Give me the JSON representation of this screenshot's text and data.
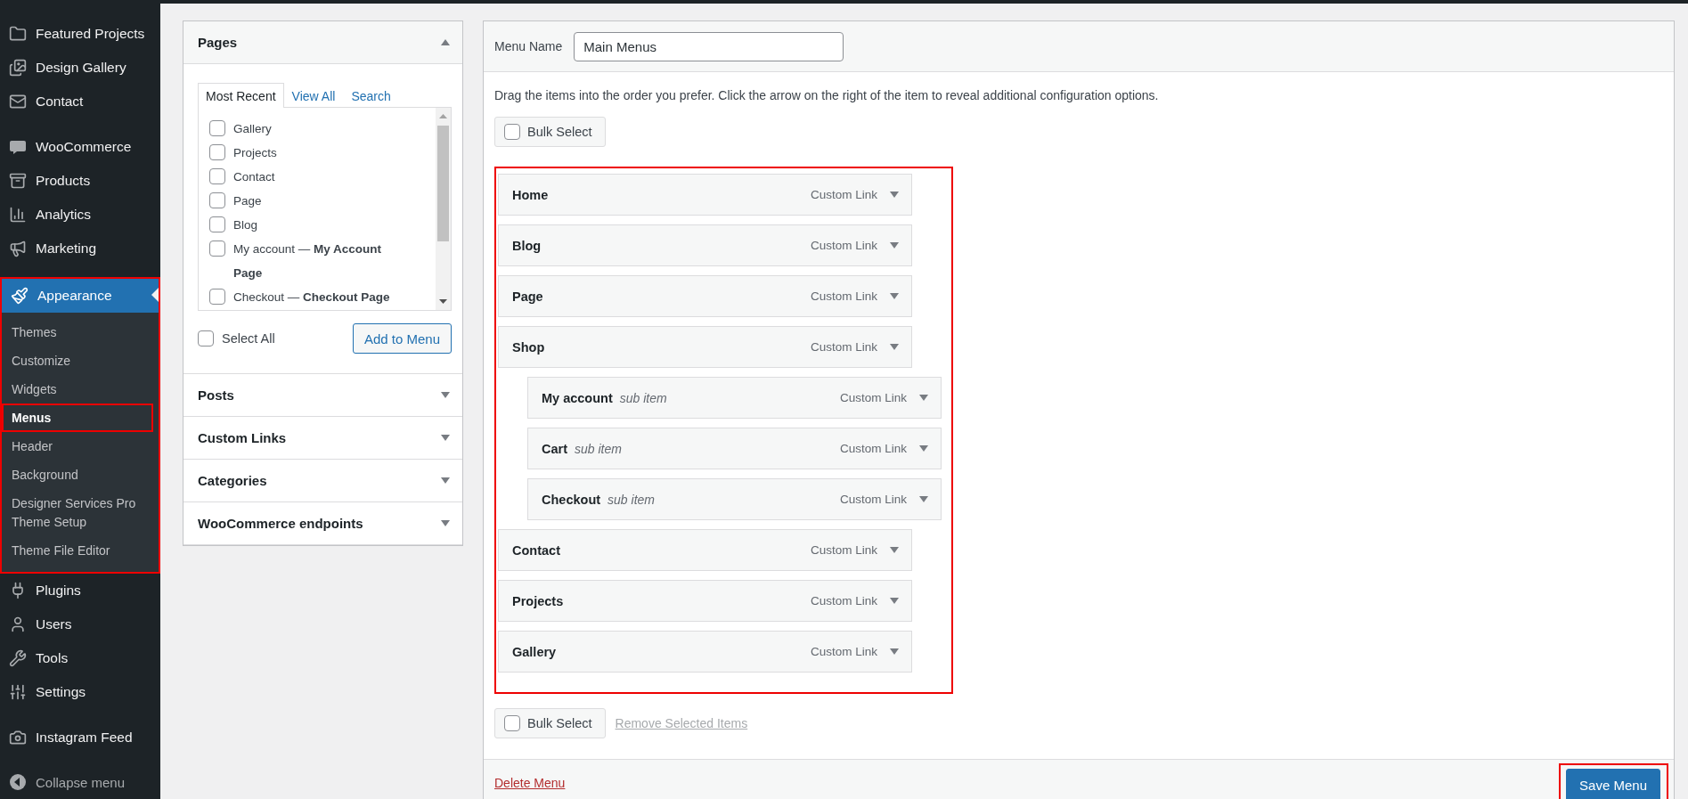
{
  "sidebar": {
    "groups": [
      {
        "items": [
          {
            "label": "Featured Projects",
            "selected": false
          },
          {
            "label": "Design Gallery",
            "selected": false
          },
          {
            "label": "Contact",
            "selected": false
          }
        ]
      },
      {
        "items": [
          {
            "label": "WooCommerce",
            "selected": false
          },
          {
            "label": "Products",
            "selected": false
          },
          {
            "label": "Analytics",
            "selected": false
          },
          {
            "label": "Marketing",
            "selected": false
          },
          {
            "label": "Appearance",
            "selected": true,
            "children": [
              {
                "label": "Themes",
                "selected": false
              },
              {
                "label": "Customize",
                "selected": false
              },
              {
                "label": "Widgets",
                "selected": false
              },
              {
                "label": "Menus",
                "selected": true
              },
              {
                "label": "Header",
                "selected": false
              },
              {
                "label": "Background",
                "selected": false
              },
              {
                "label": "Designer Services Pro Theme Setup",
                "selected": false
              },
              {
                "label": "Theme File Editor",
                "selected": false
              }
            ]
          },
          {
            "label": "Plugins",
            "selected": false
          },
          {
            "label": "Users",
            "selected": false
          },
          {
            "label": "Tools",
            "selected": false
          },
          {
            "label": "Settings",
            "selected": false
          }
        ]
      },
      {
        "items": [
          {
            "label": "Instagram Feed",
            "selected": false
          }
        ]
      }
    ],
    "collapse": {
      "label": "Collapse menu"
    }
  },
  "add_items": {
    "sections": [
      {
        "title": "Pages",
        "expanded": true,
        "tabs": [
          {
            "label": "Most Recent",
            "selected": true
          },
          {
            "label": "View All",
            "selected": false
          },
          {
            "label": "Search",
            "selected": false
          }
        ],
        "items": [
          {
            "label": "Gallery",
            "checked": false
          },
          {
            "label": "Projects",
            "checked": false
          },
          {
            "label": "Contact",
            "checked": false
          },
          {
            "label": "Page",
            "checked": false
          },
          {
            "label": "Blog",
            "checked": false
          },
          {
            "label": "My account — **My Account Page**",
            "checked": false
          },
          {
            "label": "Checkout — **Checkout Page**",
            "checked": false
          }
        ],
        "select_all": {
          "label": "Select All",
          "checked": false
        },
        "button": "Add to Menu"
      },
      {
        "title": "Posts",
        "expanded": false
      },
      {
        "title": "Custom Links",
        "expanded": false
      },
      {
        "title": "Categories",
        "expanded": false
      },
      {
        "title": "WooCommerce endpoints",
        "expanded": false
      }
    ]
  },
  "menu": {
    "name_label": "Menu Name",
    "name_value": "Main Menus",
    "instructions": "Drag the items into the order you prefer. Click the arrow on the right of the item to reveal additional configuration options.",
    "bulk_select_top": {
      "label": "Bulk Select",
      "checked": false
    },
    "items": [
      {
        "title": "Home",
        "type": "Custom Link"
      },
      {
        "title": "Blog",
        "type": "Custom Link"
      },
      {
        "title": "Page",
        "type": "Custom Link"
      },
      {
        "title": "Shop",
        "type": "Custom Link",
        "children": [
          {
            "title": "My account",
            "note": "sub item",
            "type": "Custom Link"
          },
          {
            "title": "Cart",
            "note": "sub item",
            "type": "Custom Link"
          },
          {
            "title": "Checkout",
            "note": "sub item",
            "type": "Custom Link"
          }
        ]
      },
      {
        "title": "Contact",
        "type": "Custom Link"
      },
      {
        "title": "Projects",
        "type": "Custom Link"
      },
      {
        "title": "Gallery",
        "type": "Custom Link"
      }
    ],
    "bulk_select_bottom": {
      "label": "Bulk Select",
      "checked": false
    },
    "remove_link": {
      "label": "Remove Selected Items",
      "disabled": true
    },
    "delete_link": "Delete Menu",
    "save_button": "Save Menu"
  }
}
